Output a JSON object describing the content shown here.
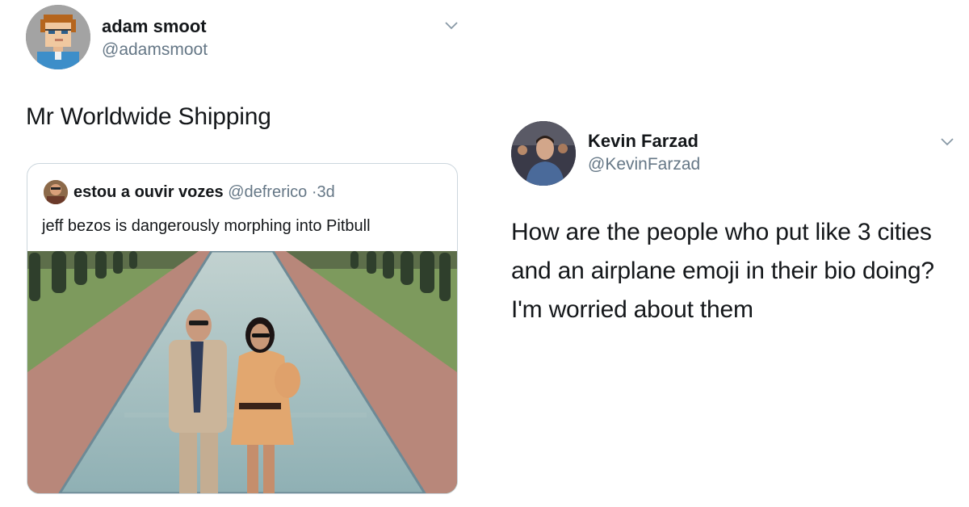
{
  "tweet_left": {
    "author": {
      "name": "adam smoot",
      "handle": "@adamsmoot"
    },
    "text": "Mr Worldwide Shipping",
    "menu_icon": "chevron-down-icon",
    "quoted_tweet": {
      "author": {
        "name": "estou a ouvir vozes",
        "handle": "@defrerico",
        "time_separator": "·",
        "time": "3d"
      },
      "text": "jeff bezos is dangerously morphing into Pitbull",
      "media": "photo-couple-at-reflecting-pool"
    }
  },
  "tweet_right": {
    "author": {
      "name": "Kevin Farzad",
      "handle": "@KevinFarzad"
    },
    "text": "How are the people who put like 3 cities and an airplane emoji in their bio doing? I'm worried about them",
    "menu_icon": "chevron-down-icon"
  },
  "colors": {
    "text_primary": "#14171a",
    "text_secondary": "#657786",
    "border": "#ccd6dd",
    "background": "#ffffff"
  }
}
